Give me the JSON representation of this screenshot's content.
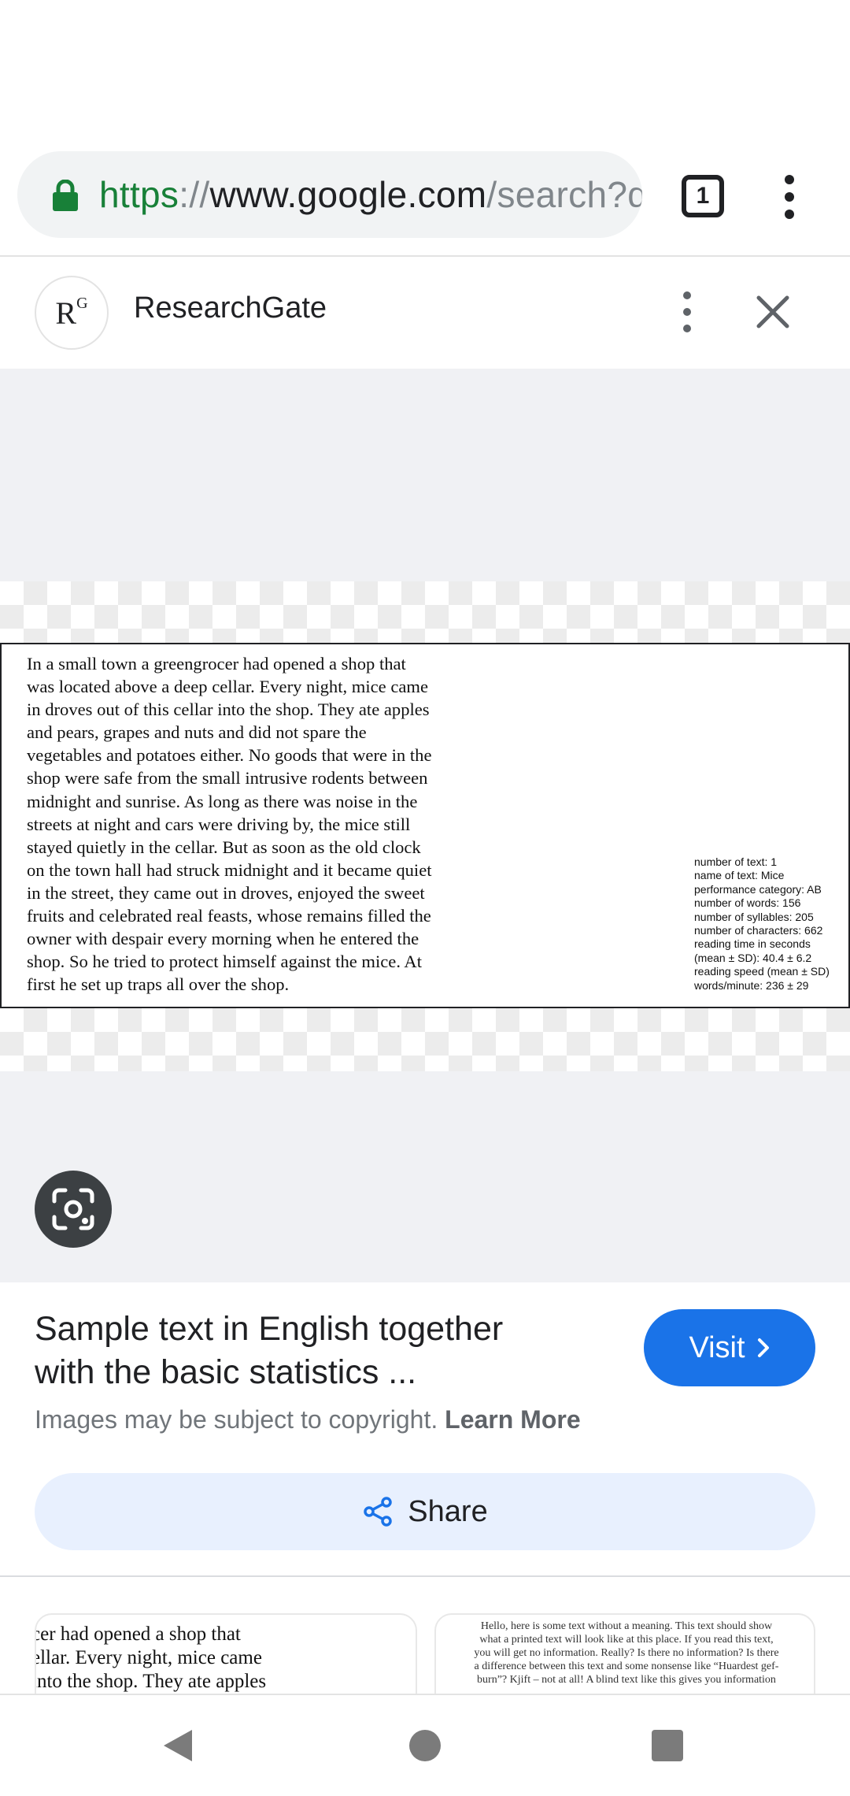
{
  "browser": {
    "url": {
      "scheme": "https",
      "separator": "://",
      "host": "www.google.com",
      "path": "/search?q"
    },
    "tab_count": "1"
  },
  "source": {
    "logo_letters": "R",
    "logo_superscript": "G",
    "name": "ResearchGate"
  },
  "image": {
    "passage_lines": [
      "In a small town a greengrocer had opened a shop that",
      "was located above a deep cellar. Every night, mice came",
      "in droves out of this cellar into the shop. They ate apples",
      "and pears, grapes and nuts and did not spare the",
      "vegetables and potatoes either. No goods that were in the",
      "shop were safe from the small intrusive rodents between",
      "midnight and sunrise. As long as there was noise in the",
      "streets at night and cars were driving by, the mice still",
      "stayed quietly in the cellar. But as soon as the old clock",
      "on the town hall had struck midnight and it became quiet",
      "in the street, they came out in droves, enjoyed the sweet",
      "fruits and celebrated real feasts, whose remains filled the",
      "owner with despair every morning when he entered the",
      "shop. So he tried to protect himself against the mice. At",
      "first he set up traps all over the shop."
    ],
    "stats_lines": [
      "number of text: 1",
      "name of text: Mice",
      "performance category: AB",
      "number of words: 156",
      "number of syllables: 205",
      "number of characters: 662",
      "reading time in seconds",
      "(mean ± SD): 40.4 ± 6.2",
      "reading speed (mean ± SD)",
      "words/minute: 236 ± 29"
    ]
  },
  "info": {
    "title_lines": [
      "Sample text in English together",
      "with the basic statistics ..."
    ],
    "visit_label": "Visit",
    "copyright_text": "Images may be subject to copyright.",
    "learn_more": "Learn More",
    "share_label": "Share"
  },
  "related": {
    "thumb1_lines": [
      "cer had opened a shop that",
      "ellar. Every night, mice came",
      "into the shop. They ate apples"
    ],
    "thumb2_lines": [
      "Hello, here is some text without a meaning. This text should show",
      "what a printed text will look like at this place. If you read this text,",
      "you will get no information. Really? Is there no information? Is there",
      "a difference between this text and some nonsense like “Huardest gef-",
      "burn”? Kjift – not at all! A blind text like this gives you information"
    ]
  },
  "colors": {
    "accent": "#1a73e8",
    "secure": "#188038",
    "share_bg": "#e8f0fe",
    "viewer_bg": "#f0f1f4"
  }
}
